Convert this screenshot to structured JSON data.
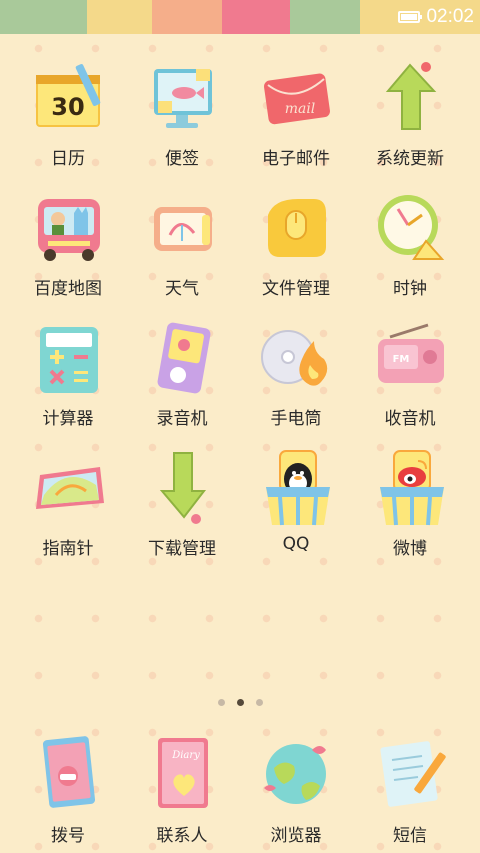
{
  "status_bar": {
    "time": "02:02",
    "stripes": [
      "#a9c99a",
      "#f4d98a",
      "#f5ae8a",
      "#f07a8f",
      "#a9c99a",
      "#f4d98a",
      "#f5ae8a"
    ],
    "battery_level": 1.0
  },
  "apps": [
    {
      "label": "日历",
      "icon": "calendar-icon"
    },
    {
      "label": "便签",
      "icon": "notes-icon"
    },
    {
      "label": "电子邮件",
      "icon": "mail-icon"
    },
    {
      "label": "系统更新",
      "icon": "update-arrow-icon"
    },
    {
      "label": "百度地图",
      "icon": "bus-map-icon"
    },
    {
      "label": "天气",
      "icon": "weather-icon"
    },
    {
      "label": "文件管理",
      "icon": "folder-icon"
    },
    {
      "label": "时钟",
      "icon": "clock-icon"
    },
    {
      "label": "计算器",
      "icon": "calculator-icon"
    },
    {
      "label": "录音机",
      "icon": "recorder-icon"
    },
    {
      "label": "手电筒",
      "icon": "flashlight-icon"
    },
    {
      "label": "收音机",
      "icon": "radio-icon"
    },
    {
      "label": "指南针",
      "icon": "compass-icon"
    },
    {
      "label": "下载管理",
      "icon": "download-icon"
    },
    {
      "label": "QQ",
      "icon": "qq-penguin-icon"
    },
    {
      "label": "微博",
      "icon": "weibo-icon"
    }
  ],
  "pager": {
    "total": 3,
    "active": 2
  },
  "dock": [
    {
      "label": "拨号",
      "icon": "phone-icon"
    },
    {
      "label": "联系人",
      "icon": "contacts-book-icon"
    },
    {
      "label": "浏览器",
      "icon": "globe-icon"
    },
    {
      "label": "短信",
      "icon": "message-icon"
    }
  ],
  "calendar_day": "30",
  "calendar_mail_word": "mail",
  "diary_word": "Diary",
  "radio_word": "FM"
}
